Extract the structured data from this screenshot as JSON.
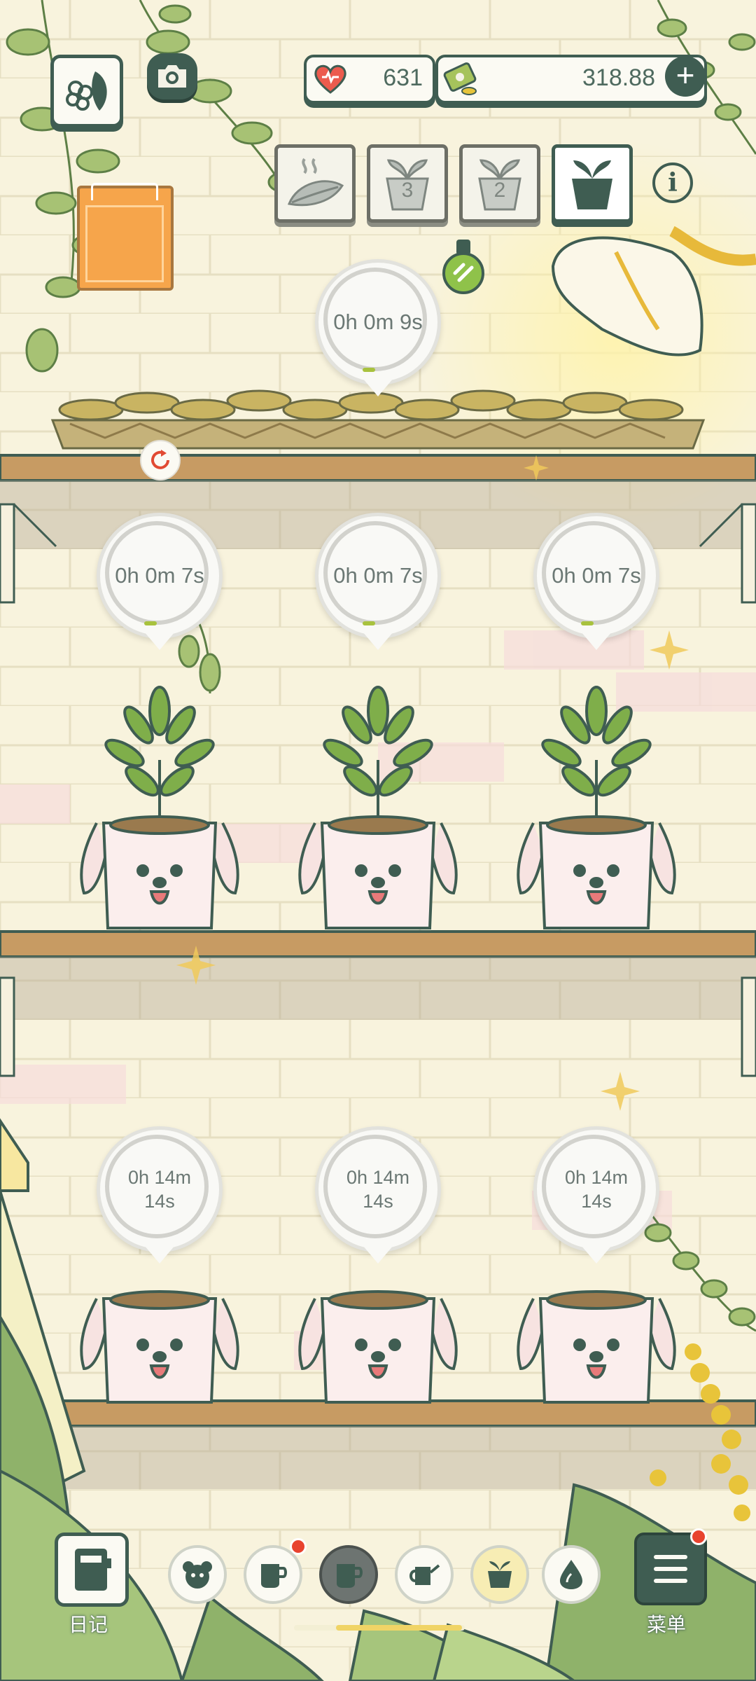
{
  "currency": {
    "hearts": "631",
    "money": "318.88"
  },
  "tabs": [
    {
      "id": "fertilizer",
      "count": ""
    },
    {
      "id": "pot-a",
      "count": "3"
    },
    {
      "id": "pot-b",
      "count": "2"
    },
    {
      "id": "pot-c",
      "count": ""
    }
  ],
  "tray_timer": "0h 0m 9s",
  "row1_timers": [
    "0h 0m 7s",
    "0h 0m 7s",
    "0h 0m 7s"
  ],
  "row2_timers": [
    {
      "line1": "0h 14m",
      "line2": "14s"
    },
    {
      "line1": "0h 14m",
      "line2": "14s"
    },
    {
      "line1": "0h 14m",
      "line2": "14s"
    }
  ],
  "bottom": {
    "diary_label": "日记",
    "menu_label": "菜单"
  },
  "colors": {
    "accent": "#3f5d52",
    "shelf": "#c79b63",
    "board": "#f6a54b",
    "progress": "#a8c23e",
    "badge": "#e8432f"
  }
}
